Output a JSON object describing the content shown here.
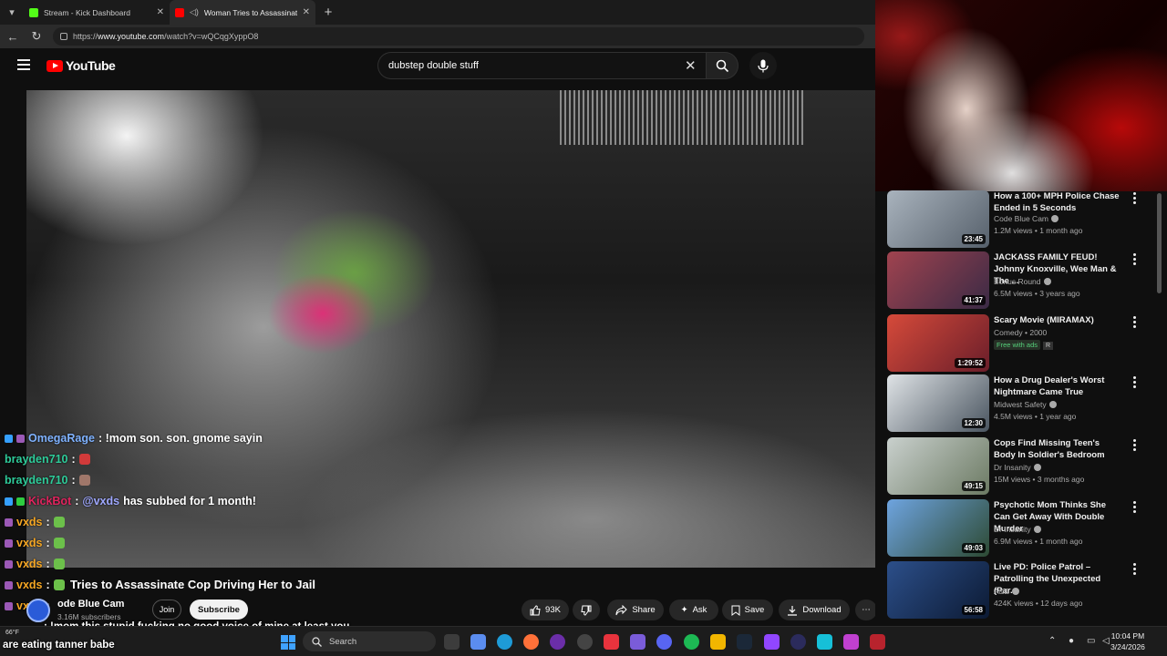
{
  "browser": {
    "tabs": [
      {
        "label": "Stream - Kick Dashboard",
        "favicon_color": "#53fc18",
        "active": false
      },
      {
        "label": "Woman Tries to Assassinate C",
        "favicon_color": "#ff0000",
        "active": true
      }
    ],
    "url_prefix": "https://",
    "url_domain": "www.youtube.com",
    "url_path": "/watch?v=wQCqgXyppO8"
  },
  "youtube": {
    "logo_text": "YouTube",
    "search_value": "dubstep double stuff"
  },
  "chat": {
    "lines": [
      {
        "user": "OmegaRage",
        "user_color": "#7fb2ff",
        "text": ": !mom son. son. gnome sayin"
      },
      {
        "user": "brayden710",
        "user_color": "#2ecc9a",
        "text": ":"
      },
      {
        "user": "brayden710",
        "user_color": "#2ecc9a",
        "text": ":"
      },
      {
        "user": "KickBot",
        "user_color": "#e0245e",
        "mention": ":",
        "target": "@vxds",
        "text": "has subbed for 1 month!"
      },
      {
        "user": "vxds",
        "user_color": "#f5a623",
        "text": ":"
      },
      {
        "user": "vxds",
        "user_color": "#f5a623",
        "text": ":"
      },
      {
        "user": "vxds",
        "user_color": "#f5a623",
        "text": ":"
      },
      {
        "user": "vxds",
        "user_color": "#f5a623",
        "text": ":"
      },
      {
        "user": "vxds",
        "user_color": "#f5a623",
        "text": ":"
      }
    ],
    "overlay_message_1": ": !mom this stupid fucking no good voice of mine at least you",
    "overlay_message_2": "are eating tanner babe"
  },
  "video": {
    "title": "Woman Tries to Assassinate Cop Driving Her to Jail",
    "title_visible": "Tries to Assassinate Cop Driving Her to Jail",
    "channel": "Code Blue Cam",
    "channel_visible": "ode Blue Cam",
    "subscribers": "3.16M subscribers",
    "join_label": "Join",
    "subscribe_label": "Subscribe",
    "likes": "93K",
    "share_label": "Share",
    "ask_label": "Ask",
    "save_label": "Save",
    "download_label": "Download"
  },
  "recommendations": [
    {
      "title": "How a 100+ MPH Police Chase Ended in 5 Seconds",
      "channel": "Code Blue Cam",
      "verified": true,
      "meta": "1.2M views • 1 month ago",
      "duration": "23:45",
      "thumb_color": "#6b7a88"
    },
    {
      "title": "JACKASS FAMILY FEUD! Johnny Knoxville, Wee Man & The ...",
      "channel": "Bonus Round",
      "verified": true,
      "meta": "6.5M views • 3 years ago",
      "duration": "41:37",
      "thumb_color": "#8a4a5a"
    },
    {
      "title": "Scary Movie (MIRAMAX)",
      "channel": "Comedy • 2000",
      "verified": false,
      "meta": "",
      "free_label": "Free with ads",
      "rating_label": "R",
      "duration": "1:29:52",
      "thumb_color": "#c0392b"
    },
    {
      "title": "How a Drug Dealer's Worst Nightmare Came True",
      "channel": "Midwest Safety",
      "verified": true,
      "meta": "4.5M views • 1 year ago",
      "duration": "12:30",
      "thumb_color": "#5a6670"
    },
    {
      "title": "Cops Find Missing Teen's Body In Soldier's Bedroom",
      "channel": "Dr Insanity",
      "verified": true,
      "meta": "15M views • 3 months ago",
      "duration": "49:15",
      "thumb_color": "#9aa3a0"
    },
    {
      "title": "Psychotic Mom Thinks She Can Get Away With Double Murder",
      "channel": "Dr Insanity",
      "verified": true,
      "meta": "6.9M views • 1 month ago",
      "duration": "49:03",
      "thumb_color": "#4c86c8"
    },
    {
      "title": "Live PD: Police Patrol – Patrolling the Unexpected (Par...",
      "channel": "A&E",
      "verified": true,
      "meta": "424K views • 12 days ago",
      "duration": "56:58",
      "thumb_color": "#1f3a66"
    }
  ],
  "taskbar": {
    "weather": "66°F",
    "search_placeholder": "Search",
    "time": "10:04 PM",
    "date": "3/24/2026"
  }
}
